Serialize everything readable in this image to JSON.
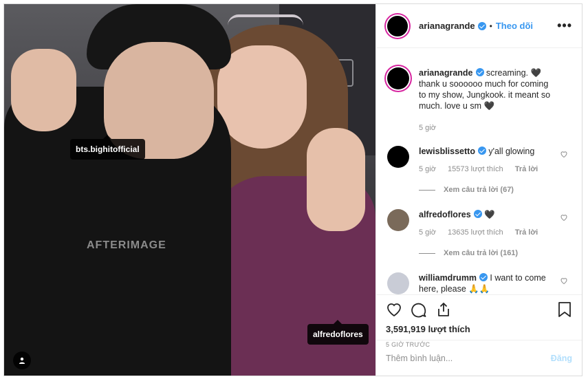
{
  "post": {
    "author": "arianagrande",
    "follow_label": "Theo dõi",
    "more_icon": "more-dots-icon",
    "image": {
      "shirt_text": "AFTERIMAGE",
      "tags": [
        "bts.bighitofficial",
        "alfredoflores"
      ]
    },
    "caption": {
      "user": "arianagrande",
      "text": "screaming. 🖤 thank u soooooo much for coming to my show, Jungkook. it meant so much. love u sm 🖤",
      "time": "5 giờ"
    },
    "comments": [
      {
        "user": "lewisblissetto",
        "text": "y'all glowing",
        "time": "5 giờ",
        "likes": "15573 lượt thích",
        "reply_label": "Trả lời",
        "view_replies": "Xem câu trả lời (67)"
      },
      {
        "user": "alfredoflores",
        "text": "🖤",
        "time": "5 giờ",
        "likes": "13635 lượt thích",
        "reply_label": "Trả lời",
        "view_replies": "Xem câu trả lời (161)"
      },
      {
        "user": "williamdrumm",
        "text": "I want to come here, please 🙏🙏"
      }
    ],
    "likes_count": "3,591,919 lượt thích",
    "posted_ago": "5 GIỜ TRƯỚC",
    "add_comment_placeholder": "Thêm bình luận...",
    "post_button": "Đăng"
  },
  "colors": {
    "accent": "#3897f0",
    "post_button_disabled": "#b2dffc",
    "muted": "#8e8e8e"
  }
}
